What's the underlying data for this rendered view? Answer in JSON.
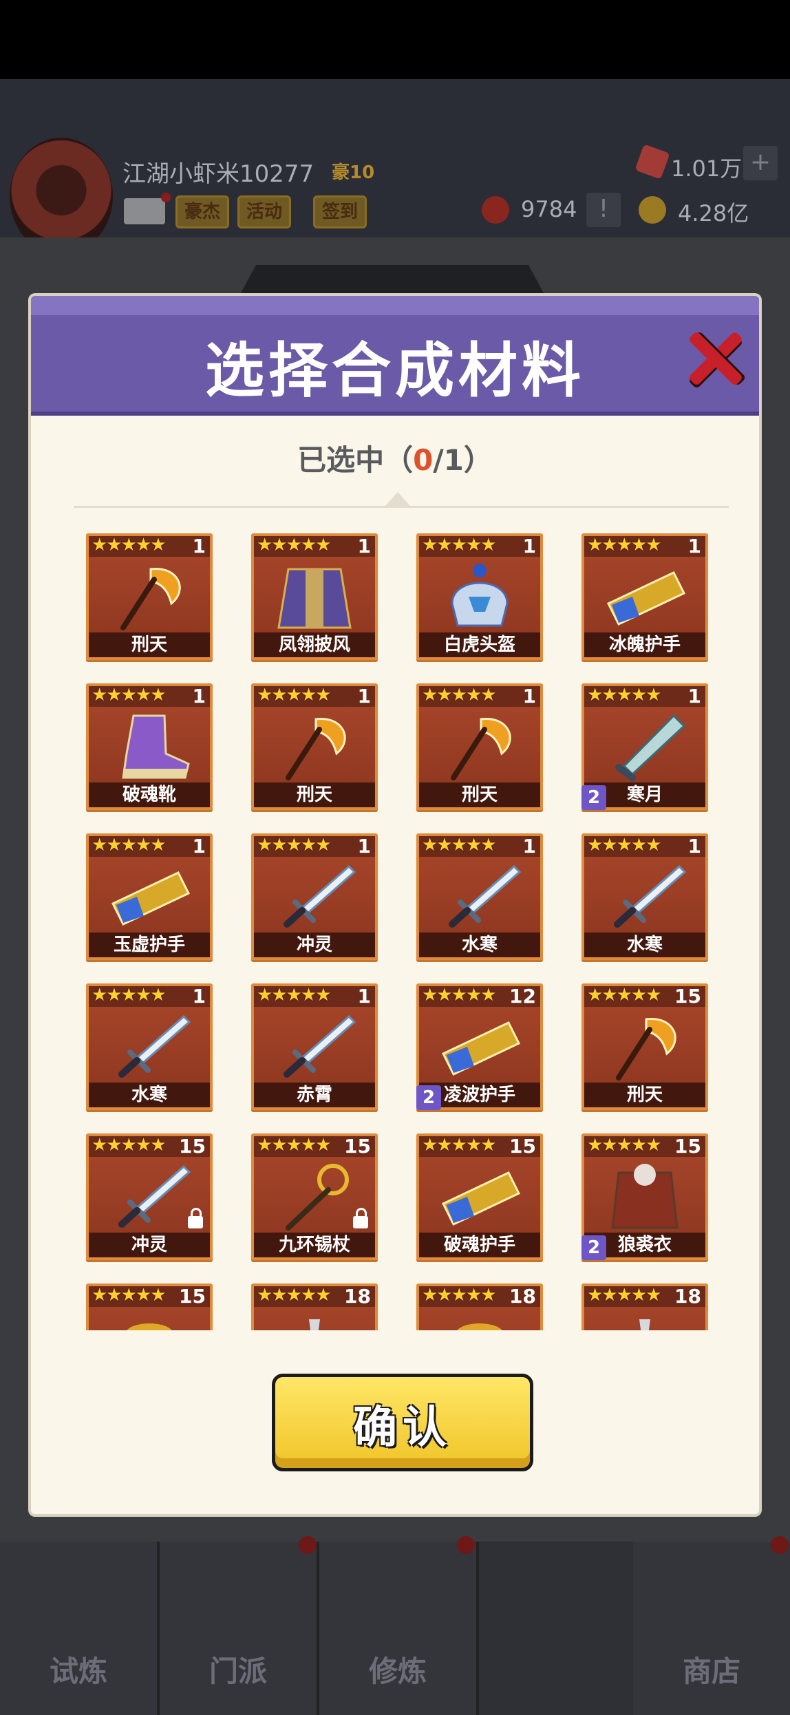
{
  "player": {
    "name": "江湖小虾米10277",
    "vip": "豪10"
  },
  "hud_buttons": [
    "豪杰",
    "活动",
    "签到"
  ],
  "resources": {
    "gems": "1.01万",
    "tokens": "9784",
    "gold": "4.28亿",
    "plus": "+",
    "alert": "!"
  },
  "modal": {
    "title": "选择合成材料",
    "selected_prefix": "已选中（",
    "selected_count": "0",
    "selected_suffix": "/1）",
    "confirm_label": "确认"
  },
  "items": [
    {
      "name": "刑天",
      "level": "1",
      "stars": "★★★★★",
      "icon": "axe-icon",
      "badge": "",
      "locked": false
    },
    {
      "name": "凤翎披风",
      "level": "1",
      "stars": "★★★★★",
      "icon": "cape-icon",
      "badge": "",
      "locked": false
    },
    {
      "name": "白虎头盔",
      "level": "1",
      "stars": "★★★★★",
      "icon": "helmet-icon",
      "badge": "",
      "locked": false
    },
    {
      "name": "冰魄护手",
      "level": "1",
      "stars": "★★★★★",
      "icon": "gauntlet-icon",
      "badge": "",
      "locked": false
    },
    {
      "name": "破魂靴",
      "level": "1",
      "stars": "★★★★★",
      "icon": "boot-icon",
      "badge": "",
      "locked": false
    },
    {
      "name": "刑天",
      "level": "1",
      "stars": "★★★★★",
      "icon": "axe-icon",
      "badge": "",
      "locked": false
    },
    {
      "name": "刑天",
      "level": "1",
      "stars": "★★★★★",
      "icon": "axe-icon",
      "badge": "",
      "locked": false
    },
    {
      "name": "寒月",
      "level": "1",
      "stars": "★★★★★",
      "icon": "blade-icon",
      "badge": "2",
      "locked": false
    },
    {
      "name": "玉虚护手",
      "level": "1",
      "stars": "★★★★★",
      "icon": "gauntlet-icon",
      "badge": "",
      "locked": false
    },
    {
      "name": "冲灵",
      "level": "1",
      "stars": "★★★★★",
      "icon": "sword-icon",
      "badge": "",
      "locked": false
    },
    {
      "name": "水寒",
      "level": "1",
      "stars": "★★★★★",
      "icon": "sword-icon",
      "badge": "",
      "locked": false
    },
    {
      "name": "水寒",
      "level": "1",
      "stars": "★★★★★",
      "icon": "sword-icon",
      "badge": "",
      "locked": false
    },
    {
      "name": "水寒",
      "level": "1",
      "stars": "★★★★★",
      "icon": "sword-icon",
      "badge": "",
      "locked": false
    },
    {
      "name": "赤霄",
      "level": "1",
      "stars": "★★★★★",
      "icon": "sword-icon",
      "badge": "",
      "locked": false
    },
    {
      "name": "凌波护手",
      "level": "12",
      "stars": "★★★★★",
      "icon": "gauntlet-icon",
      "badge": "2",
      "locked": false
    },
    {
      "name": "刑天",
      "level": "15",
      "stars": "★★★★★",
      "icon": "axe-icon",
      "badge": "",
      "locked": false
    },
    {
      "name": "冲灵",
      "level": "15",
      "stars": "★★★★★",
      "icon": "sword-icon",
      "badge": "",
      "locked": true
    },
    {
      "name": "九环锡杖",
      "level": "15",
      "stars": "★★★★★",
      "icon": "staff-icon",
      "badge": "",
      "locked": true
    },
    {
      "name": "破魂护手",
      "level": "15",
      "stars": "★★★★★",
      "icon": "gauntlet-icon",
      "badge": "",
      "locked": false
    },
    {
      "name": "狼裘衣",
      "level": "15",
      "stars": "★★★★★",
      "icon": "armor-icon",
      "badge": "2",
      "locked": false
    },
    {
      "name": "",
      "level": "15",
      "stars": "★★★★★",
      "icon": "ring-icon",
      "badge": "",
      "locked": false
    },
    {
      "name": "",
      "level": "18",
      "stars": "★★★★★",
      "icon": "weapon-icon",
      "badge": "",
      "locked": false
    },
    {
      "name": "",
      "level": "18",
      "stars": "★★★★★",
      "icon": "ring-icon",
      "badge": "",
      "locked": false
    },
    {
      "name": "",
      "level": "18",
      "stars": "★★★★★",
      "icon": "weapon-icon",
      "badge": "",
      "locked": false
    }
  ],
  "bottom_nav": [
    "试炼",
    "门派",
    "修炼",
    "",
    "商店"
  ],
  "colors": {
    "header": "#6b5aa8",
    "card": "#a8472a",
    "accent": "#e0512b",
    "confirm": "#f0c428"
  }
}
